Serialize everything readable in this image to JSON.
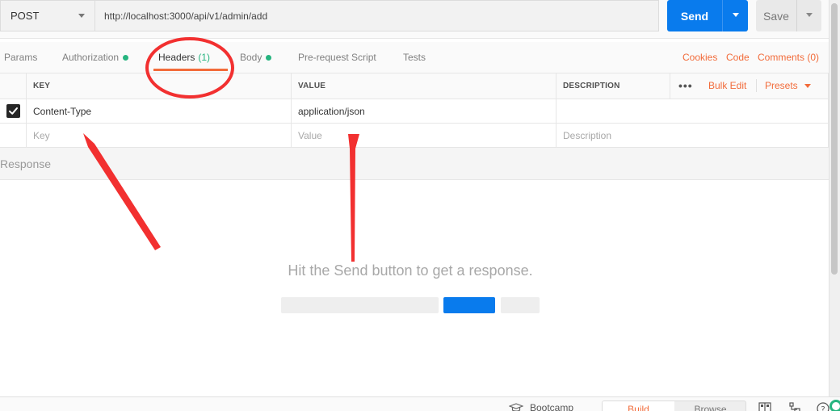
{
  "request": {
    "method": "POST",
    "url": "http://localhost:3000/api/v1/admin/add",
    "send_label": "Send",
    "save_label": "Save"
  },
  "tabs": [
    {
      "label": "Params"
    },
    {
      "label": "Authorization"
    },
    {
      "label": "Headers",
      "count": "(1)"
    },
    {
      "label": "Body"
    },
    {
      "label": "Pre-request Script"
    },
    {
      "label": "Tests"
    }
  ],
  "right_links": {
    "cookies": "Cookies",
    "code": "Code",
    "comments": "Comments (0)"
  },
  "headers_table": {
    "columns": {
      "key": "KEY",
      "value": "VALUE",
      "description": "DESCRIPTION"
    },
    "more_label": "•••",
    "bulk_edit": "Bulk Edit",
    "presets": "Presets",
    "rows": [
      {
        "key": "Content-Type",
        "value": "application/json",
        "description": ""
      }
    ],
    "new_row": {
      "key": "Key",
      "value": "Value",
      "description": "Description"
    }
  },
  "response": {
    "title": "Response",
    "empty_message": "Hit the Send button to get a response."
  },
  "status_bar": {
    "bootcamp": "Bootcamp",
    "build": "Build",
    "browse": "Browse"
  },
  "colors": {
    "accent_orange": "#f26b3a",
    "send_blue": "#097bed",
    "green_dot": "#26b47f",
    "annotation_red": "#f23030"
  }
}
